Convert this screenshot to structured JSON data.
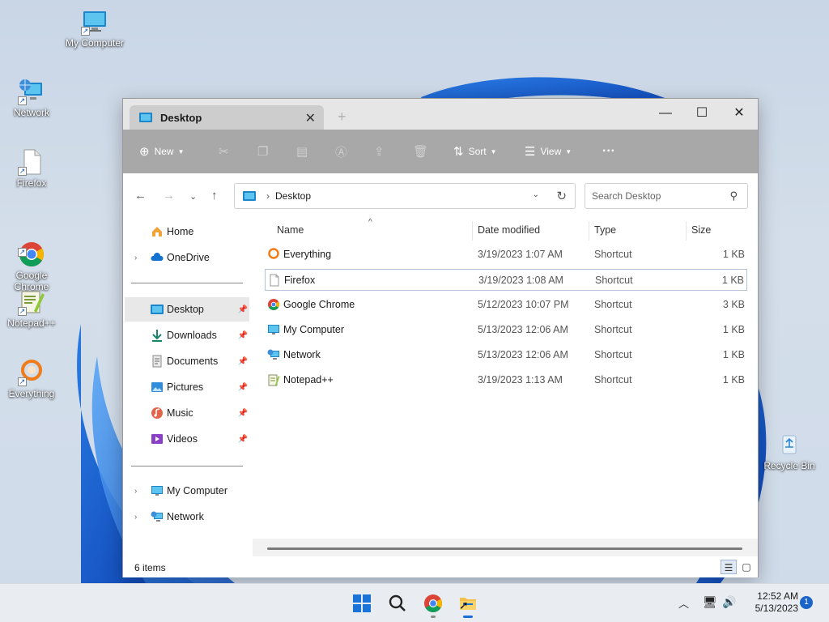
{
  "desktop": {
    "icons": [
      {
        "label": "My Computer",
        "icon": "monitor-icon"
      },
      {
        "label": "Network",
        "icon": "network-icon"
      },
      {
        "label": "Firefox",
        "icon": "document-shortcut-icon"
      },
      {
        "label": "Google\nChrome",
        "icon": "chrome-icon"
      },
      {
        "label": "Notepad++",
        "icon": "notepad-plus-plus-icon"
      },
      {
        "label": "Everything",
        "icon": "everything-icon"
      },
      {
        "label": "Recycle Bin",
        "icon": "recycle-bin-icon"
      }
    ]
  },
  "window": {
    "tab_title": "Desktop",
    "tab_close": "✕",
    "new_tab": "+",
    "controls": {
      "minimize": "—",
      "maximize": "☐",
      "close": "✕"
    },
    "toolbar": {
      "new_label": "New",
      "sort_label": "Sort",
      "view_label": "View",
      "more_label": "···"
    },
    "address": {
      "crumb": "Desktop",
      "search_placeholder": "Search Desktop"
    },
    "nav": {
      "home": "Home",
      "onedrive": "OneDrive",
      "desktop": "Desktop",
      "downloads": "Downloads",
      "documents": "Documents",
      "pictures": "Pictures",
      "music": "Music",
      "videos": "Videos",
      "my_computer": "My Computer",
      "network": "Network"
    },
    "columns": {
      "name": "Name",
      "date": "Date modified",
      "type": "Type",
      "size": "Size"
    },
    "files": [
      {
        "name": "Everything",
        "date": "3/19/2023 1:07 AM",
        "type": "Shortcut",
        "size": "1 KB",
        "icon": "everything-icon"
      },
      {
        "name": "Firefox",
        "date": "3/19/2023 1:08 AM",
        "type": "Shortcut",
        "size": "1 KB",
        "icon": "document-shortcut-icon"
      },
      {
        "name": "Google Chrome",
        "date": "5/12/2023 10:07 PM",
        "type": "Shortcut",
        "size": "3 KB",
        "icon": "chrome-icon"
      },
      {
        "name": "My Computer",
        "date": "5/13/2023 12:06 AM",
        "type": "Shortcut",
        "size": "1 KB",
        "icon": "monitor-icon"
      },
      {
        "name": "Network",
        "date": "5/13/2023 12:06 AM",
        "type": "Shortcut",
        "size": "1 KB",
        "icon": "network-icon"
      },
      {
        "name": "Notepad++",
        "date": "3/19/2023 1:13 AM",
        "type": "Shortcut",
        "size": "1 KB",
        "icon": "notepad-plus-plus-icon"
      }
    ],
    "status": "6 items"
  },
  "taskbar": {
    "time": "12:52 AM",
    "date": "5/13/2023",
    "notification_count": "1"
  },
  "colors": {
    "accent": "#1a6fd6",
    "toolbar_bg": "#a8a8a8",
    "selection_bg": "#e8e8e8"
  }
}
